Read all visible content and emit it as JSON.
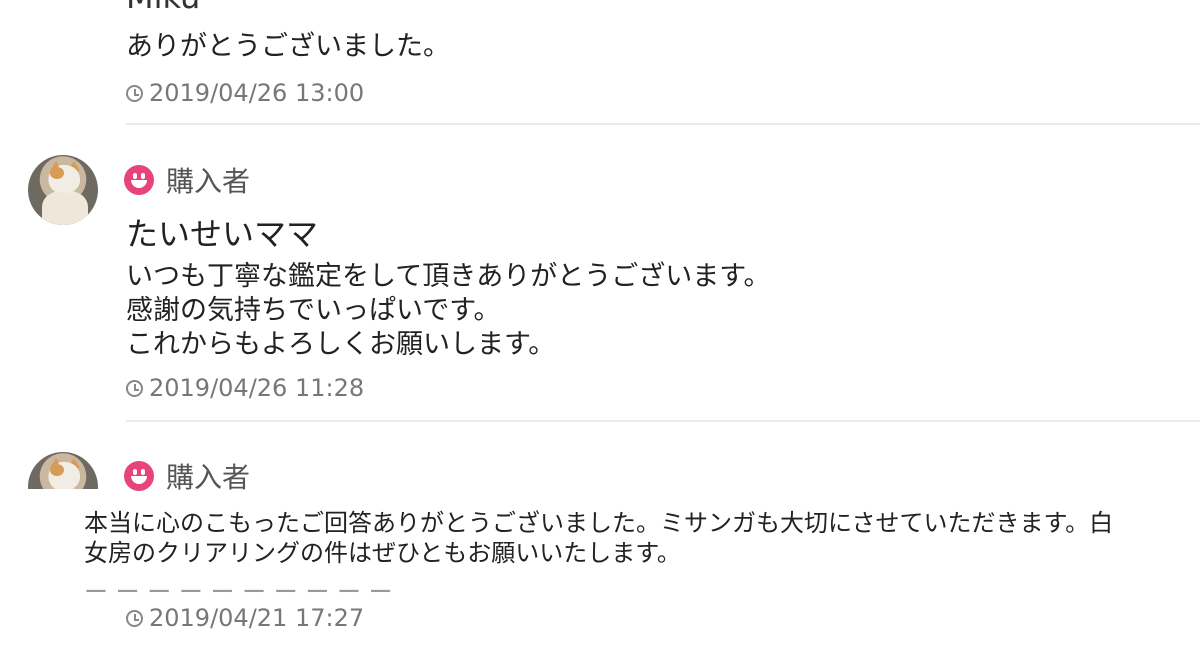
{
  "entries": [
    {
      "name": "Miku",
      "message": "ありがとうございました。",
      "timestamp": "2019/04/26 13:00"
    },
    {
      "badge": "購入者",
      "name": "たいせいママ",
      "message_lines": [
        "いつも丁寧な鑑定をして頂きありがとうございます。",
        "感謝の気持ちでいっぱいです。",
        "これからもよろしくお願いします。"
      ],
      "timestamp": "2019/04/26 11:28"
    },
    {
      "badge": "購入者",
      "message_lines": [
        "本当に心のこもったご回答ありがとうございました。ミサンガも大切にさせていただきます。白",
        "女房のクリアリングの件はぜひともお願いいたします。"
      ],
      "timestamp": "2019/04/21 17:27"
    }
  ],
  "colors": {
    "badge_icon": "#e8437d",
    "timestamp_text": "#777777",
    "divider": "#ececec"
  },
  "icons": {
    "timestamp": "clock-icon",
    "badge": "smiley-icon"
  }
}
